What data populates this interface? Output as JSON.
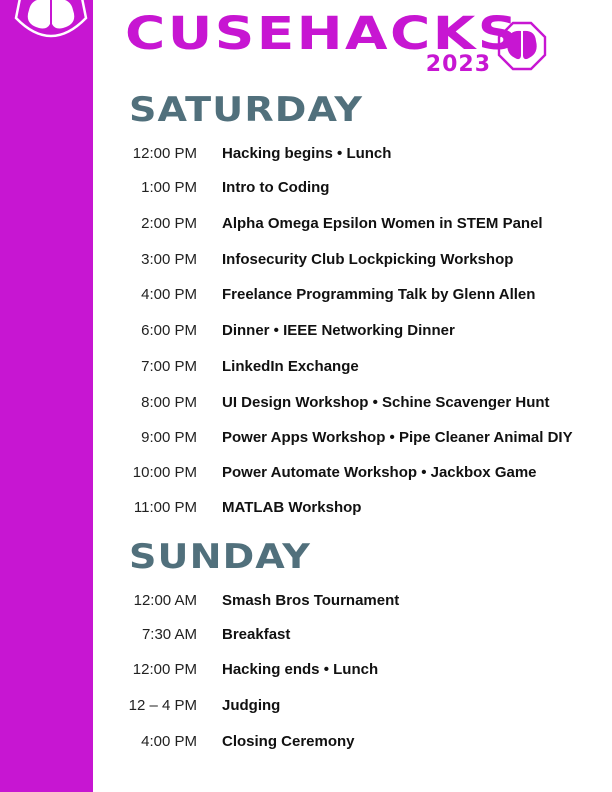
{
  "header": {
    "title": "CUSEHACKS",
    "year": "2023"
  },
  "colors": {
    "brand": "#c716d2",
    "heading": "#51707c",
    "text": "#111111"
  },
  "saturday": {
    "heading": "SATURDAY",
    "events": [
      {
        "time": "12:00 PM",
        "event": "Hacking begins • Lunch"
      },
      {
        "time": "1:00 PM",
        "event": "Intro to Coding"
      },
      {
        "time": "2:00 PM",
        "event": "Alpha Omega Epsilon Women in STEM Panel"
      },
      {
        "time": "3:00 PM",
        "event": "Infosecurity Club Lockpicking Workshop"
      },
      {
        "time": "4:00 PM",
        "event": "Freelance Programming Talk by Glenn Allen"
      },
      {
        "time": "6:00 PM",
        "event": "Dinner • IEEE Networking Dinner"
      },
      {
        "time": "7:00 PM",
        "event": "LinkedIn Exchange"
      },
      {
        "time": "8:00 PM",
        "event": "UI Design Workshop • Schine Scavenger Hunt"
      },
      {
        "time": "9:00 PM",
        "event": "Power Apps Workshop • Pipe Cleaner Animal DIY"
      },
      {
        "time": "10:00 PM",
        "event": "Power Automate Workshop • Jackbox Game"
      },
      {
        "time": "11:00 PM",
        "event": "MATLAB Workshop"
      }
    ]
  },
  "sunday": {
    "heading": "SUNDAY",
    "events": [
      {
        "time": "12:00 AM",
        "event": "Smash Bros Tournament"
      },
      {
        "time": "7:30 AM",
        "event": "Breakfast"
      },
      {
        "time": "12:00 PM",
        "event": "Hacking ends  • Lunch"
      },
      {
        "time": "12 – 4 PM",
        "event": "Judging"
      },
      {
        "time": "4:00 PM",
        "event": "Closing Ceremony"
      }
    ]
  }
}
